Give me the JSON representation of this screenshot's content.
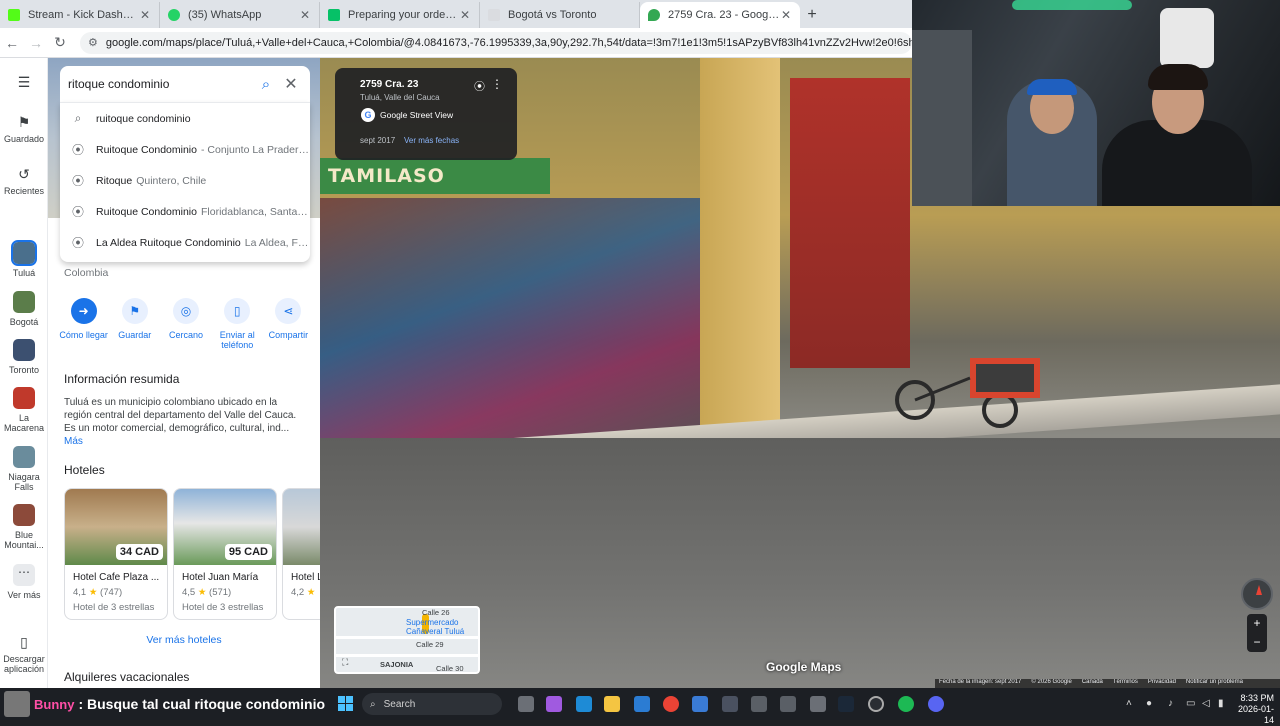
{
  "browser": {
    "tabs": [
      {
        "label": "Stream - Kick Dashboard",
        "color": "#53fc18",
        "active": false
      },
      {
        "label": "(35) WhatsApp",
        "color": "#25d366",
        "active": false
      },
      {
        "label": "Preparing your order... | Uber E",
        "color": "#06c167",
        "active": false
      },
      {
        "label": "Bogotá vs Toronto",
        "color": "#dadce0",
        "active": false
      },
      {
        "label": "2759 Cra. 23 - Google Maps",
        "color": "#34a853",
        "active": true
      }
    ],
    "new_tab": "+",
    "url": "google.com/maps/place/Tuluá,+Valle+del+Cauca,+Colombia/@4.0841673,-76.1995339,3a,90y,292.7h,54t/data=!3m7!1e1!3m5!1sAPzyBVf83lh41vnZZv2Hvw!2e0!6shttps:%2F%2Fstreetviewpixels-pa..."
  },
  "rail": {
    "menu_icon": "menu-icon",
    "items": [
      {
        "label": "Guardado",
        "icon": "bookmark-icon"
      },
      {
        "label": "Recientes",
        "icon": "history-icon"
      },
      {
        "label": "Tuluá",
        "thumb": "#4a6f8c",
        "active": true
      },
      {
        "label": "Bogotá",
        "thumb": "#5b7d4a"
      },
      {
        "label": "Toronto",
        "thumb": "#3c5070"
      },
      {
        "label": "La Macarena",
        "thumb": "#c0392b"
      },
      {
        "label": "Niagara Falls",
        "thumb": "#6a8c9c"
      },
      {
        "label": "Blue Mountai...",
        "thumb": "#8c4a3a"
      },
      {
        "label": "Ver más",
        "icon": "more-icon"
      },
      {
        "label": "Descargar aplicación",
        "icon": "phone-icon"
      }
    ]
  },
  "search": {
    "value": "ritoque condominio",
    "suggestions": [
      {
        "main": "ruitoque condominio",
        "sub": "",
        "icon": "search-icon"
      },
      {
        "main": "Ruitoque Condominio",
        "sub": "- Conjunto La Pradera...",
        "icon": "pin-icon"
      },
      {
        "main": "Ritoque",
        "sub": "Quintero, Chile",
        "icon": "pin-icon"
      },
      {
        "main": "Ruitoque Condominio",
        "sub": "Floridablanca, Santan...",
        "icon": "pin-icon"
      },
      {
        "main": "La Aldea Ruitoque Condominio",
        "sub": "La Aldea, Flo...",
        "icon": "pin-icon"
      }
    ]
  },
  "place": {
    "country": "Colombia",
    "actions": [
      {
        "label": "Cómo llegar",
        "icon": "directions-icon"
      },
      {
        "label": "Guardar",
        "icon": "bookmark-icon"
      },
      {
        "label": "Cercano",
        "icon": "nearby-icon"
      },
      {
        "label": "Enviar al teléfono",
        "icon": "send-phone-icon"
      },
      {
        "label": "Compartir",
        "icon": "share-icon"
      }
    ],
    "summary_title": "Información resumida",
    "summary": "Tuluá es un municipio colombiano ubicado en la región central del departamento del Valle del Cauca. Es un motor comercial, demográfico, cultural, ind...",
    "more": "Más",
    "hotels_title": "Hoteles",
    "hotels": [
      {
        "name": "Hotel Cafe Plaza ...",
        "price": "34 CAD",
        "rating": "4,1",
        "reviews": "(747)",
        "type": "Hotel de 3 estrellas"
      },
      {
        "name": "Hotel Juan María",
        "price": "95 CAD",
        "rating": "4,5",
        "reviews": "(571)",
        "type": "Hotel de 3 estrellas"
      },
      {
        "name": "Hotel L",
        "price": "",
        "rating": "4,2",
        "reviews": "",
        "type": ""
      }
    ],
    "more_hotels": "Ver más hoteles",
    "vacation_title": "Alquileres vacacionales"
  },
  "streetview": {
    "address": "2759 Cra. 23",
    "locality": "Tuluá, Valle del Cauca",
    "badge": "Google Street View",
    "date": "sept 2017",
    "more_dates": "Ver más fechas",
    "shop_sign": "TAMILASO",
    "brand": "Google Maps",
    "footer": [
      "Fecha de la imagen: sept 2017",
      "© 2026 Google",
      "Canadá",
      "Términos",
      "Privacidad",
      "Notificar un problema"
    ],
    "minimap": {
      "poi": "Supermercado Cañaveral Tuluá",
      "area": "SAJONIA",
      "streets": [
        "Calle 29",
        "Calle 30",
        "Calle 26"
      ]
    }
  },
  "stream": {
    "username": "Bunny",
    "message": ": Busque tal cual ritoque condominio"
  },
  "taskbar": {
    "search": "Search",
    "time": "8:33 PM",
    "date": "2026-01-14"
  }
}
